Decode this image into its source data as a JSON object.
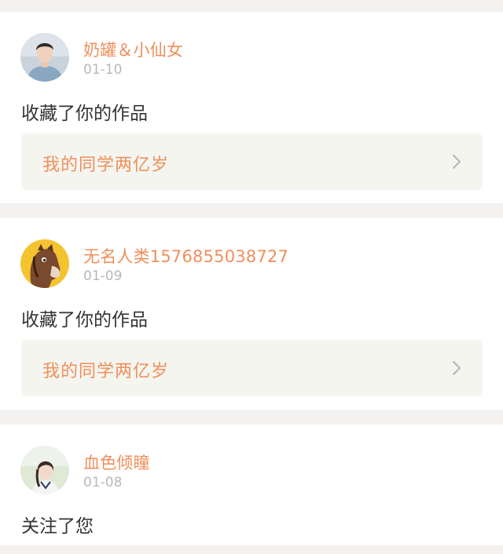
{
  "notifications": [
    {
      "user_name": "奶罐＆小仙女",
      "date": "01-10",
      "action": "收藏了你的作品",
      "work_title": "我的同学两亿岁",
      "avatar_icon": "avatar-young-man-photo"
    },
    {
      "user_name": "无名人类1576855038727",
      "date": "01-09",
      "action": "收藏了你的作品",
      "work_title": "我的同学两亿岁",
      "avatar_icon": "avatar-cartoon-horse"
    },
    {
      "user_name": "血色倾瞳",
      "date": "01-08",
      "action": "关注了您"
    }
  ],
  "colors": {
    "accent": "#ef8f5b",
    "date_text": "#b8b8b8",
    "body_text": "#333333",
    "link_card_bg": "#f5f5f0",
    "page_bg": "#f4f2f1"
  },
  "icons": {
    "chevron": "chevron-right-icon"
  }
}
